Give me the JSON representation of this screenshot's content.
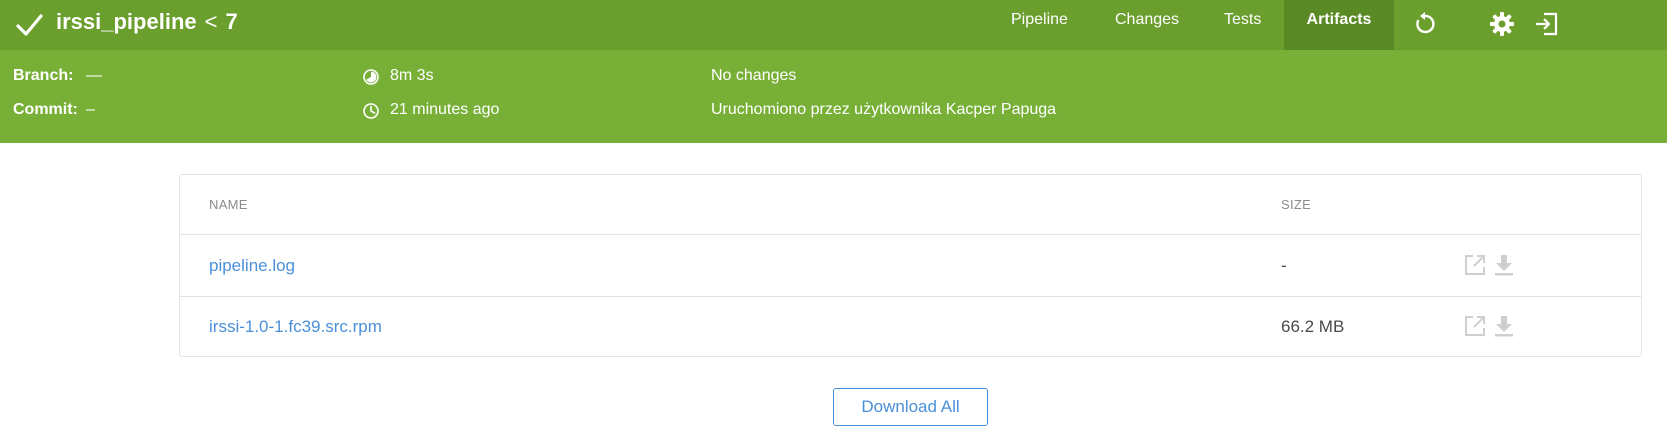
{
  "header": {
    "pipeline_name": "irssi_pipeline",
    "separator": "<",
    "run_number": "7",
    "nav": {
      "pipeline": "Pipeline",
      "changes": "Changes",
      "tests": "Tests",
      "artifacts": "Artifacts"
    },
    "icons": {
      "status": "checkmark-icon",
      "rerun": "rerun-icon",
      "settings": "gear-icon",
      "exit": "exit-icon"
    }
  },
  "summary": {
    "branch_label": "Branch:",
    "branch_value": "—",
    "commit_label": "Commit:",
    "commit_value": "–",
    "duration": "8m 3s",
    "started": "21 minutes ago",
    "changes": "No changes",
    "cause": "Uruchomiono przez użytkownika Kacper Papuga"
  },
  "artifacts": {
    "columns": {
      "name": "NAME",
      "size": "SIZE"
    },
    "rows": [
      {
        "name": "pipeline.log",
        "size": "-"
      },
      {
        "name": "irssi-1.0-1.fc39.src.rpm",
        "size": "66.2 MB"
      }
    ],
    "download_all": "Download All"
  },
  "colors": {
    "header": "#6a9e2d",
    "subbar": "#78b037",
    "link": "#4a90d9"
  }
}
